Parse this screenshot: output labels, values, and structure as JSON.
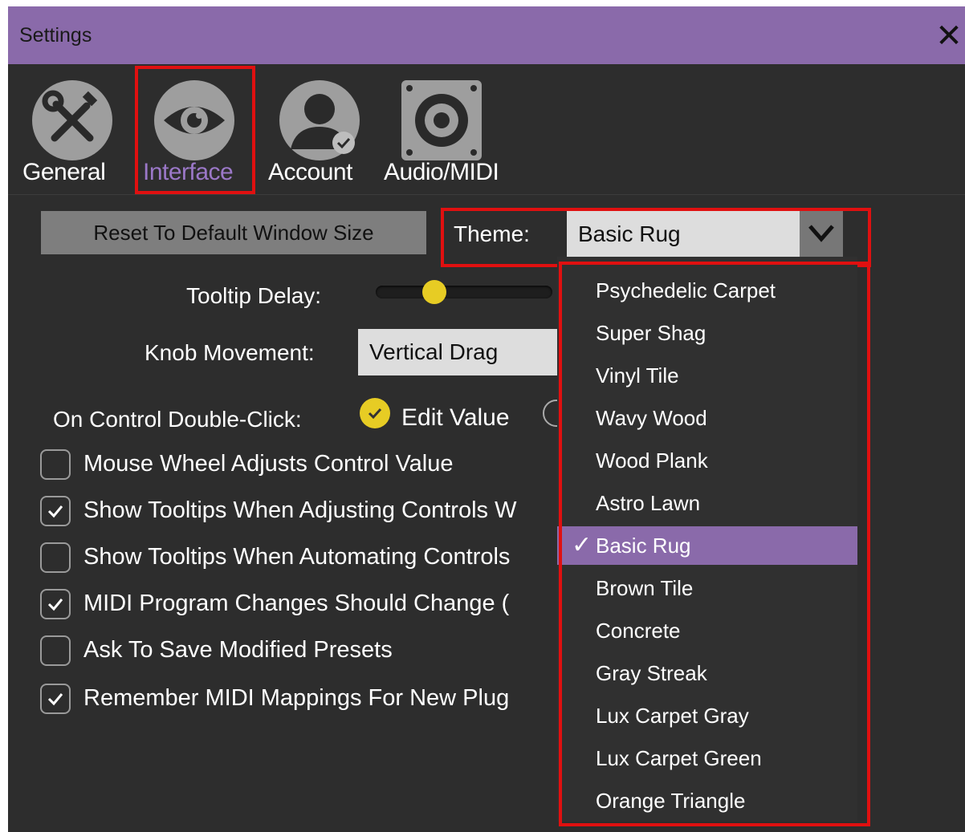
{
  "window": {
    "title": "Settings",
    "close_glyph": "✕"
  },
  "tabs": [
    {
      "label": "General",
      "icon": "tools-icon",
      "active": false
    },
    {
      "label": "Interface",
      "icon": "eye-icon",
      "active": true
    },
    {
      "label": "Account",
      "icon": "user-icon",
      "active": false
    },
    {
      "label": "Audio/MIDI",
      "icon": "speaker-icon",
      "active": false
    }
  ],
  "interface": {
    "reset_button": "Reset To Default Window Size",
    "theme_label": "Theme:",
    "theme_value": "Basic Rug",
    "tooltip_delay_label": "Tooltip Delay:",
    "tooltip_delay_value": 0.3,
    "knob_movement_label": "Knob Movement:",
    "knob_movement_value": "Vertical Drag",
    "double_click_label": "On Control Double-Click:",
    "double_click_option": "Edit Value",
    "checkboxes": [
      {
        "label": "Mouse Wheel Adjusts Control Value",
        "checked": false
      },
      {
        "label": "Show Tooltips When Adjusting Controls W",
        "checked": true
      },
      {
        "label": "Show Tooltips When Automating Controls",
        "checked": false
      },
      {
        "label": "MIDI Program Changes Should Change (",
        "checked": true
      },
      {
        "label": "Ask To Save Modified Presets",
        "checked": false
      },
      {
        "label": "Remember MIDI Mappings For New Plug",
        "checked": true
      }
    ]
  },
  "theme_dropdown": {
    "items": [
      "Psychedelic Carpet",
      "Super Shag",
      "Vinyl Tile",
      "Wavy Wood",
      "Wood Plank",
      "Astro Lawn",
      "Basic Rug",
      "Brown Tile",
      "Concrete",
      "Gray Streak",
      "Lux Carpet Gray",
      "Lux Carpet Green",
      "Orange Triangle"
    ],
    "selected": "Basic Rug",
    "check_glyph": "✓"
  },
  "colors": {
    "accent": "#8a6aaa",
    "highlight": "#e01010",
    "toggle": "#e7cc24",
    "background": "#2d2d2d"
  }
}
